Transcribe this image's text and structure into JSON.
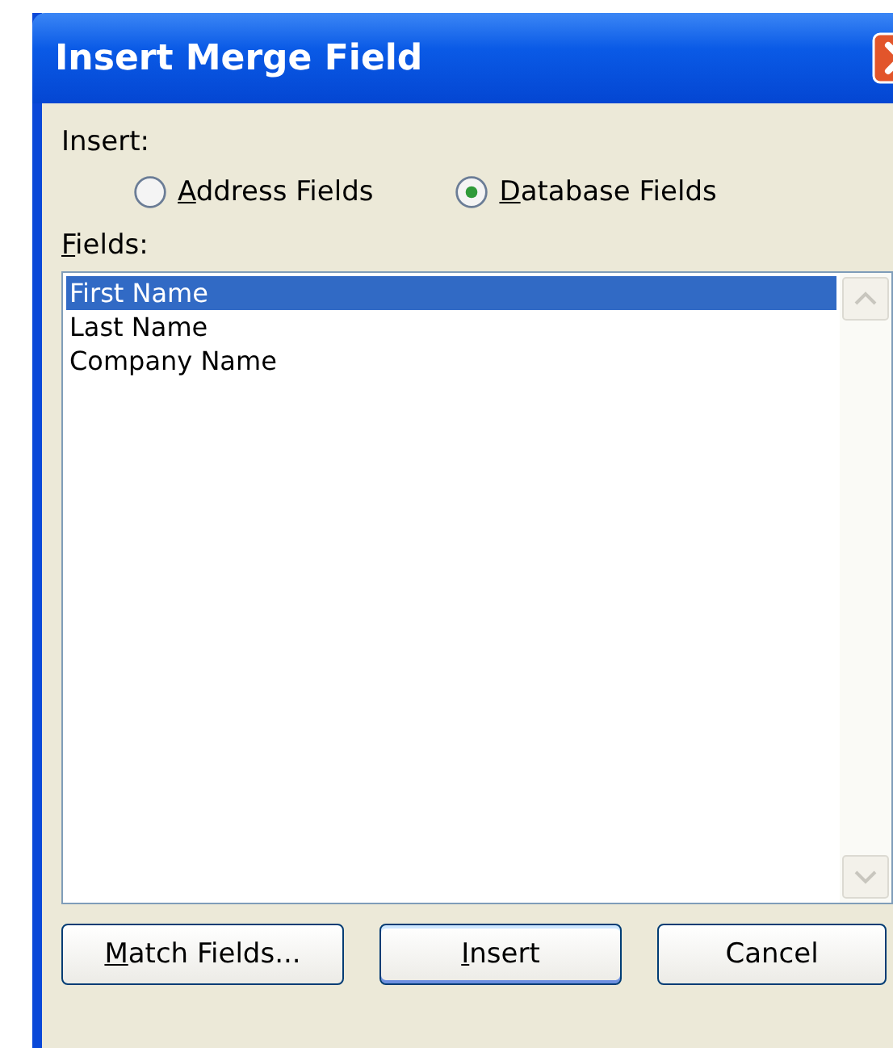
{
  "window": {
    "title": "Insert Merge Field"
  },
  "insert_label": {
    "text": "Insert:",
    "underline_first": false
  },
  "radios": [
    {
      "label": "Address Fields",
      "selected": false,
      "underline_first": true
    },
    {
      "label": "Database Fields",
      "selected": true,
      "underline_first": true
    }
  ],
  "fields_label": {
    "text": "Fields:",
    "underline_first": true
  },
  "fields": [
    {
      "label": "First Name",
      "selected": true
    },
    {
      "label": "Last Name",
      "selected": false
    },
    {
      "label": "Company Name",
      "selected": false
    }
  ],
  "buttons": [
    {
      "label": "Match Fields...",
      "default": false,
      "underline_first": true
    },
    {
      "label": "Insert",
      "default": true,
      "underline_first": true
    },
    {
      "label": "Cancel",
      "default": false,
      "underline_first": false
    }
  ]
}
